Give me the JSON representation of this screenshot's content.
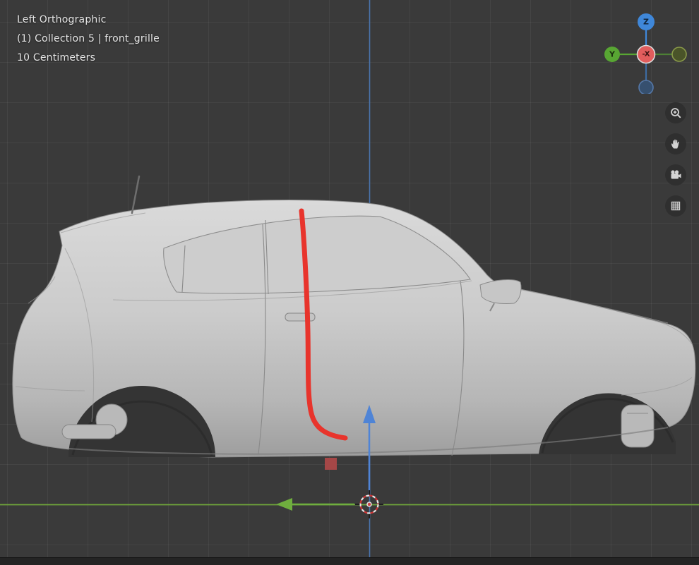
{
  "header": {
    "view_label": "Left Orthographic",
    "collection_label": "(1) Collection 5 | front_grille",
    "scale_label": "10 Centimeters"
  },
  "gizmo": {
    "axis_z_label": "Z",
    "axis_y_label": "Y",
    "axis_neg_x_label": "-X"
  },
  "toolbar": {
    "buttons": [
      "zoom-in",
      "pan",
      "camera-view",
      "grid-overlay"
    ]
  },
  "scene": {
    "object": "car body shell (side view, no wheels)",
    "annotation": "red grease-pencil stroke along door front edge",
    "cursor": "3d-cursor at world origin"
  },
  "colors": {
    "background": "#3a3a3a",
    "grid_line": "rgba(255,255,255,0.05)",
    "axis_z": "#4a74ad",
    "axis_y": "#6fa53a",
    "gizmo_z": "#3f87d9",
    "gizmo_y": "#58a633",
    "gizmo_x_neg": "#e25d5d",
    "annotation": "#e8342c",
    "marker": "#a54747",
    "text": "#e6e6e6",
    "toolbar_icon": "#d4d4d4",
    "toolbar_button_bg": "rgba(45,45,45,0.88)"
  }
}
